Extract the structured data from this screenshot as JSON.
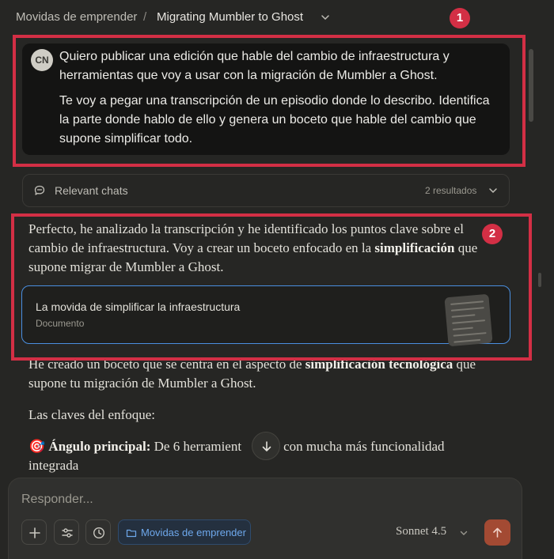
{
  "header": {
    "project": "Movidas de emprender",
    "separator": "/",
    "title": "Migrating Mumbler to Ghost"
  },
  "annotations": {
    "badge_1": "1",
    "badge_2": "2",
    "color": "#d32f45"
  },
  "user_message": {
    "avatar_initials": "CN",
    "paragraphs": [
      "Quiero publicar una edición que hable del cambio de infraestructura y herramientas que voy a usar con la migración de Mumbler a Ghost.",
      "Te voy a pegar una transcripción de un episodio donde lo describo. Identifica la parte donde hablo de ello y genera un boceto que hable del cambio que supone simplificar todo."
    ]
  },
  "relevant_chats": {
    "label": "Relevant chats",
    "count": "2 resultados"
  },
  "assistant": {
    "intro_1": "Perfecto, he analizado la transcripción y he identificado los puntos clave sobre el cambio de infraestructura. Voy a crear un boceto enfocado en la",
    "intro_bold": "simplificación",
    "intro_2": "que supone migrar de Mumbler a Ghost.",
    "artifact": {
      "title": "La movida de simplificar la infraestructura",
      "type": "Documento",
      "accent": "#4a8fe0"
    },
    "para2_1": "He creado un boceto que se centra en el aspecto de",
    "para2_bold1": "simplificación",
    "para2_bold2": "tecnológica",
    "para2_2": "que supone tu migración de Mumbler a Ghost.",
    "para3": "Las claves del enfoque:",
    "bullet_icon": "🎯",
    "bullet_bold": "Ángulo principal:",
    "bullet_text_a": "De 6 herramient",
    "bullet_text_b": "4, con mucha más funcionalidad",
    "bullet_text_c": "integrada"
  },
  "composer": {
    "placeholder": "Responder...",
    "project_chip": "Movidas de emprender",
    "model": "Sonnet 4.5",
    "send_color": "#a34a33"
  }
}
